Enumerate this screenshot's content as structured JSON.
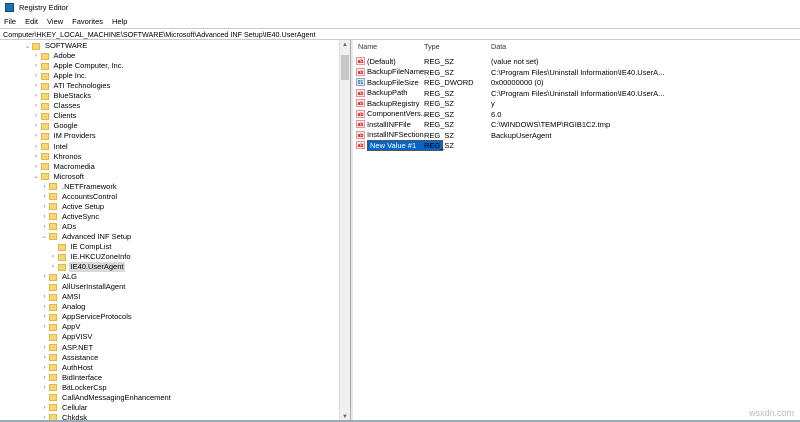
{
  "window": {
    "title": "Registry Editor"
  },
  "menu": [
    "File",
    "Edit",
    "View",
    "Favorites",
    "Help"
  ],
  "address": "Computer\\HKEY_LOCAL_MACHINE\\SOFTWARE\\Microsoft\\Advanced INF Setup\\IE40.UserAgent",
  "tree": [
    {
      "label": "SOFTWARE",
      "level": 0,
      "state": "expanded"
    },
    {
      "label": "Adobe",
      "level": 1,
      "state": "collapsed"
    },
    {
      "label": "Apple Computer, Inc.",
      "level": 1,
      "state": "collapsed"
    },
    {
      "label": "Apple Inc.",
      "level": 1,
      "state": "collapsed"
    },
    {
      "label": "ATI Technologies",
      "level": 1,
      "state": "collapsed"
    },
    {
      "label": "BlueStacks",
      "level": 1,
      "state": "collapsed"
    },
    {
      "label": "Classes",
      "level": 1,
      "state": "collapsed"
    },
    {
      "label": "Clients",
      "level": 1,
      "state": "collapsed"
    },
    {
      "label": "Google",
      "level": 1,
      "state": "collapsed"
    },
    {
      "label": "IM Providers",
      "level": 1,
      "state": "collapsed"
    },
    {
      "label": "Intel",
      "level": 1,
      "state": "collapsed"
    },
    {
      "label": "Khronos",
      "level": 1,
      "state": "collapsed"
    },
    {
      "label": "Macromedia",
      "level": 1,
      "state": "collapsed"
    },
    {
      "label": "Microsoft",
      "level": 1,
      "state": "expanded"
    },
    {
      "label": ".NETFramework",
      "level": 2,
      "state": "collapsed"
    },
    {
      "label": "AccountsControl",
      "level": 2,
      "state": "collapsed"
    },
    {
      "label": "Active Setup",
      "level": 2,
      "state": "collapsed"
    },
    {
      "label": "ActiveSync",
      "level": 2,
      "state": "collapsed"
    },
    {
      "label": "ADs",
      "level": 2,
      "state": "collapsed"
    },
    {
      "label": "Advanced INF Setup",
      "level": 2,
      "state": "expanded"
    },
    {
      "label": "IE CompList",
      "level": 3,
      "state": "leaf"
    },
    {
      "label": "IE.HKCUZoneInfo",
      "level": 3,
      "state": "collapsed"
    },
    {
      "label": "IE40.UserAgent",
      "level": 3,
      "state": "collapsed",
      "selected": true
    },
    {
      "label": "ALG",
      "level": 2,
      "state": "collapsed"
    },
    {
      "label": "AllUserInstallAgent",
      "level": 2,
      "state": "leaf"
    },
    {
      "label": "AMSI",
      "level": 2,
      "state": "collapsed"
    },
    {
      "label": "Analog",
      "level": 2,
      "state": "collapsed"
    },
    {
      "label": "AppServiceProtocols",
      "level": 2,
      "state": "collapsed"
    },
    {
      "label": "AppV",
      "level": 2,
      "state": "collapsed"
    },
    {
      "label": "AppVISV",
      "level": 2,
      "state": "leaf"
    },
    {
      "label": "ASP.NET",
      "level": 2,
      "state": "collapsed"
    },
    {
      "label": "Assistance",
      "level": 2,
      "state": "collapsed"
    },
    {
      "label": "AuthHost",
      "level": 2,
      "state": "collapsed"
    },
    {
      "label": "BidInterface",
      "level": 2,
      "state": "collapsed"
    },
    {
      "label": "BitLockerCsp",
      "level": 2,
      "state": "collapsed"
    },
    {
      "label": "CallAndMessagingEnhancement",
      "level": 2,
      "state": "leaf"
    },
    {
      "label": "Cellular",
      "level": 2,
      "state": "collapsed"
    },
    {
      "label": "Chkdsk",
      "level": 2,
      "state": "collapsed"
    }
  ],
  "list": {
    "columns": [
      "Name",
      "Type",
      "Data"
    ],
    "rows": [
      {
        "name": "(Default)",
        "type": "REG_SZ",
        "data": "(value not set)",
        "icon": "string-value-icon"
      },
      {
        "name": "BackupFileName",
        "type": "REG_SZ",
        "data": "C:\\Program Files\\Uninstall Information\\IE40.UserA...",
        "icon": "string-value-icon"
      },
      {
        "name": "BackupFileSize",
        "type": "REG_DWORD",
        "data": "0x00000000 (0)",
        "icon": "binary-value-icon"
      },
      {
        "name": "BackupPath",
        "type": "REG_SZ",
        "data": "C:\\Program Files\\Uninstall Information\\IE40.UserA...",
        "icon": "string-value-icon"
      },
      {
        "name": "BackupRegistry",
        "type": "REG_SZ",
        "data": "y",
        "icon": "string-value-icon"
      },
      {
        "name": "ComponentVers...",
        "type": "REG_SZ",
        "data": "6.0",
        "icon": "string-value-icon"
      },
      {
        "name": "InstallINFFile",
        "type": "REG_SZ",
        "data": "C:\\WINDOWS\\TEMP\\RGIB1C2.tmp",
        "icon": "string-value-icon"
      },
      {
        "name": "InstallINFSection",
        "type": "REG_SZ",
        "data": "BackupUserAgent",
        "icon": "string-value-icon"
      },
      {
        "name": "New Value #1",
        "type": "REG_SZ",
        "data": "",
        "icon": "string-value-icon",
        "editing": true
      }
    ]
  },
  "watermark": "wsxdn.com"
}
